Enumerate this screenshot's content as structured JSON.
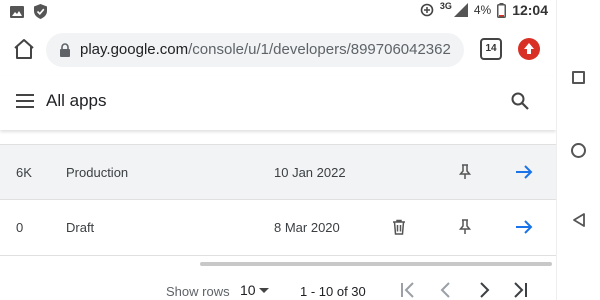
{
  "status_bar": {
    "network": "3G",
    "battery": "4%",
    "time": "12:04"
  },
  "browser": {
    "url_domain": "play.google.com",
    "url_path": "/console/u/1/developers/899706042362",
    "tab_count": "14"
  },
  "header": {
    "title": "All apps"
  },
  "table": {
    "rows": [
      {
        "installs": "6K",
        "status": "Production",
        "last_updated": "10 Jan 2022",
        "has_delete": false
      },
      {
        "installs": "0",
        "status": "Draft",
        "last_updated": "8 Mar 2020",
        "has_delete": true
      }
    ]
  },
  "pagination": {
    "rows_label": "Show rows",
    "rows_value": "10",
    "range": "1 - 10 of 30"
  },
  "colors": {
    "accent": "#1a73e8",
    "row_highlight": "#f1f3f4"
  }
}
